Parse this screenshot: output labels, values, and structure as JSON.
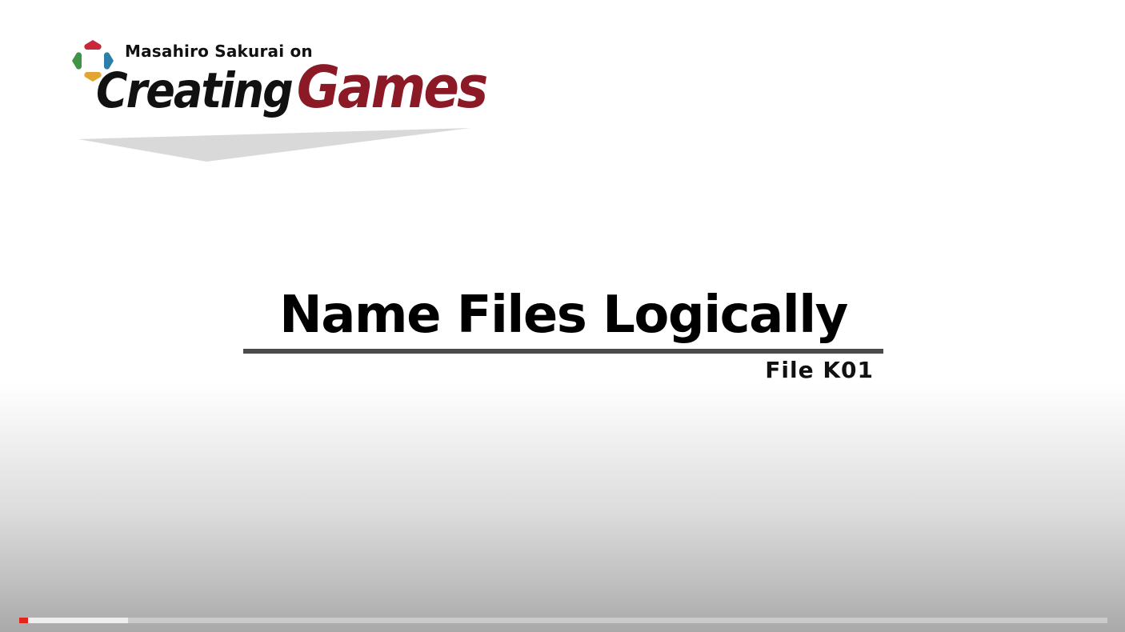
{
  "logo": {
    "owner_line": "Masahiro Sakurai on",
    "title_part_1": "Creating",
    "title_part_2": "Games",
    "colors": {
      "title_dark": "#111111",
      "title_accent": "#8b1a26",
      "mark_red": "#c8283a",
      "mark_green": "#3f9446",
      "mark_blue": "#2c7fa8",
      "mark_yellow": "#e3a531",
      "banner_gray": "#d9d9d9"
    }
  },
  "episode": {
    "title": "Name Files Logically",
    "file_id": "File K01"
  },
  "player": {
    "progress_fraction": 0.008,
    "buffered_fraction": 0.1,
    "colors": {
      "played": "#e1251b"
    }
  }
}
